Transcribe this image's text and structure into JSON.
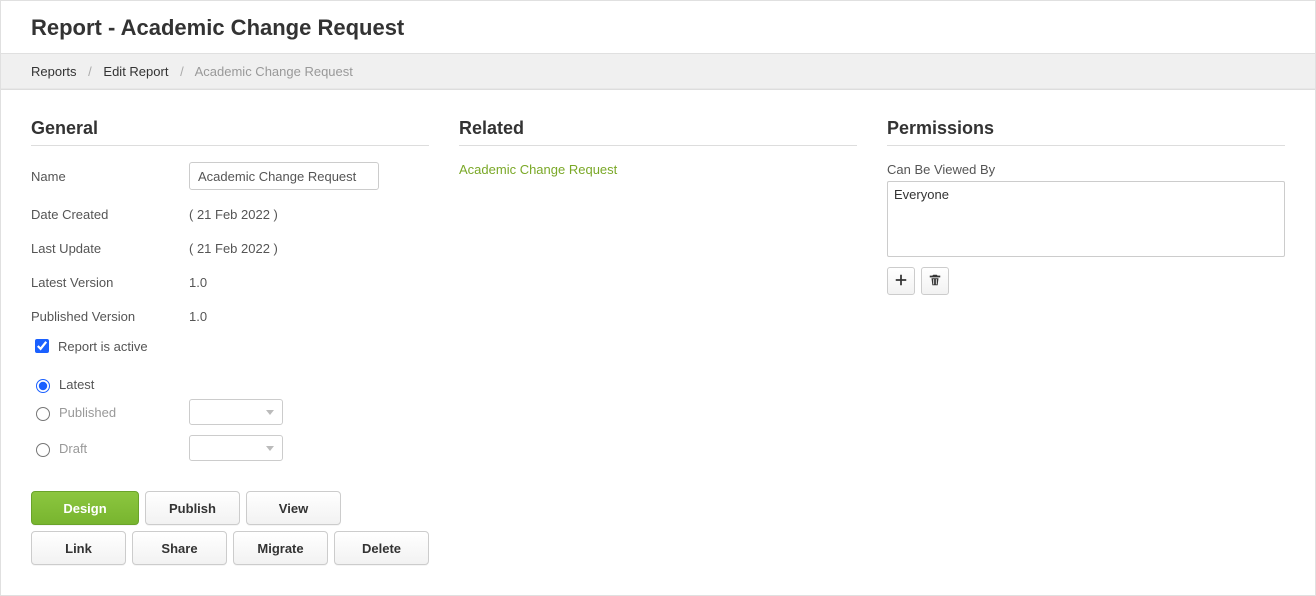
{
  "header": {
    "title": "Report - Academic Change Request"
  },
  "breadcrumb": {
    "reports": "Reports",
    "edit_report": "Edit Report",
    "current": "Academic Change Request"
  },
  "general": {
    "section_title": "General",
    "name_label": "Name",
    "name_value": "Academic Change Request",
    "date_created_label": "Date Created",
    "date_created_value": "( 21 Feb 2022 )",
    "last_update_label": "Last Update",
    "last_update_value": "( 21 Feb 2022 )",
    "latest_version_label": "Latest Version",
    "latest_version_value": "1.0",
    "published_version_label": "Published Version",
    "published_version_value": "1.0",
    "active_label": "Report is active",
    "radio_latest": "Latest",
    "radio_published": "Published",
    "radio_draft": "Draft"
  },
  "related": {
    "section_title": "Related",
    "link_text": "Academic Change Request"
  },
  "permissions": {
    "section_title": "Permissions",
    "viewed_by_label": "Can Be Viewed By",
    "options": [
      "Everyone"
    ]
  },
  "buttons": {
    "design": "Design",
    "publish": "Publish",
    "view": "View",
    "link": "Link",
    "share": "Share",
    "migrate": "Migrate",
    "delete": "Delete"
  }
}
